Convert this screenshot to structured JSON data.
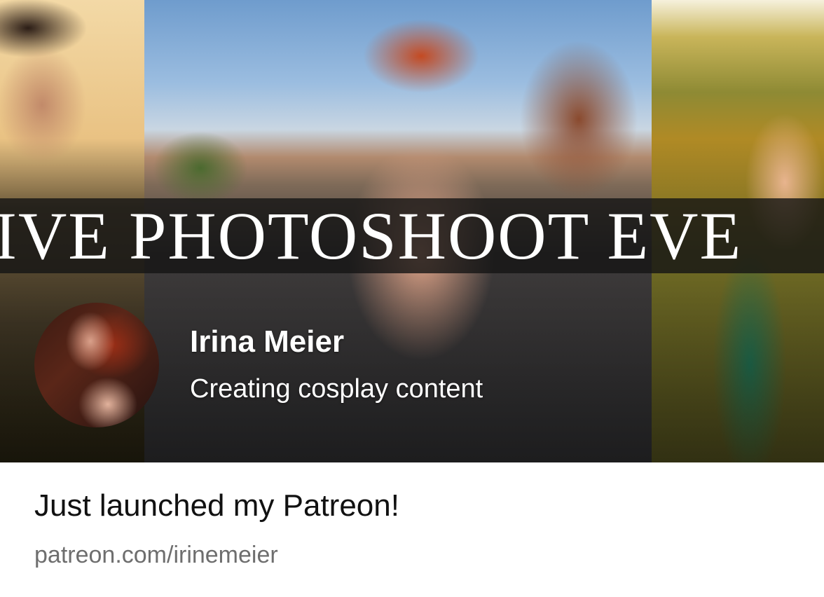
{
  "banner": {
    "overlay_text": "IVE PHOTOSHOOT EVE",
    "creator_name": "Irina Meier",
    "tagline": "Creating cosplay content"
  },
  "post": {
    "title": "Just launched my Patreon!",
    "url": "patreon.com/irinemeier"
  }
}
